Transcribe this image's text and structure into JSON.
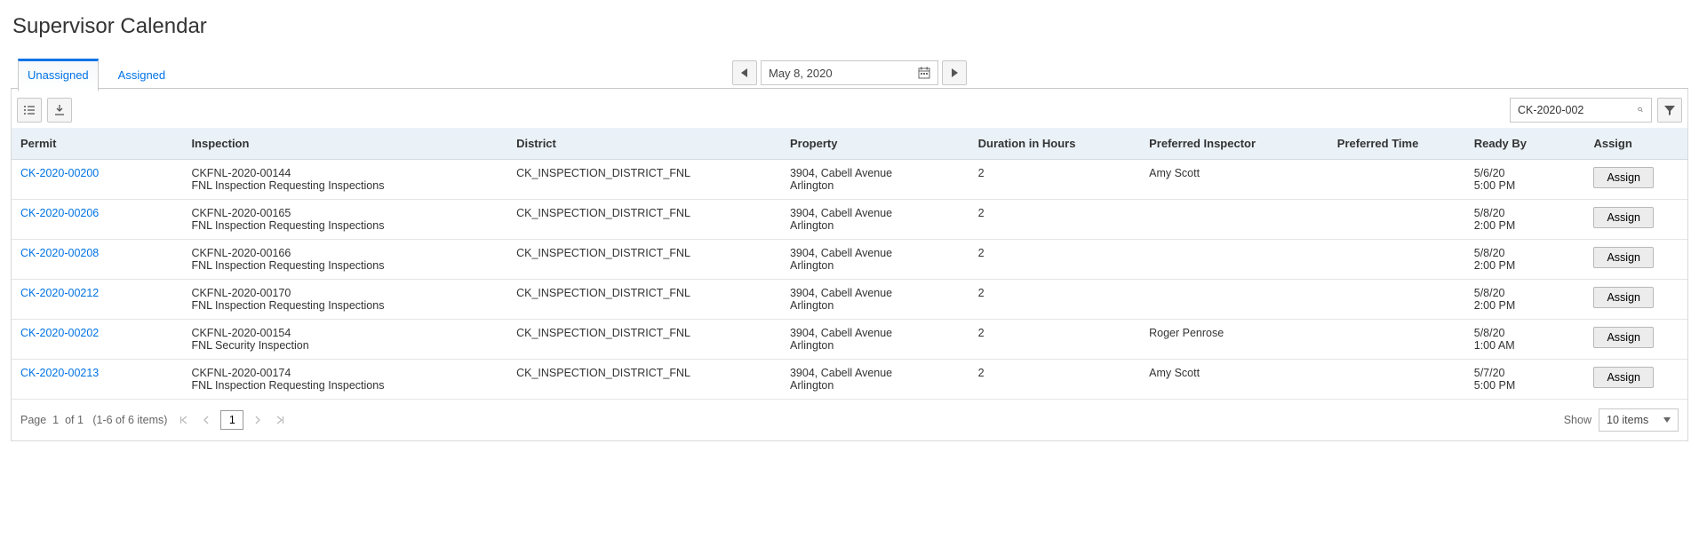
{
  "page_title": "Supervisor Calendar",
  "tabs": {
    "unassigned": "Unassigned",
    "assigned": "Assigned"
  },
  "date_value": "May 8, 2020",
  "search_value": "CK-2020-002",
  "columns": {
    "permit": "Permit",
    "inspection": "Inspection",
    "district": "District",
    "property": "Property",
    "duration": "Duration in Hours",
    "preferred_inspector": "Preferred Inspector",
    "preferred_time": "Preferred Time",
    "ready_by": "Ready By",
    "assign": "Assign"
  },
  "assign_label": "Assign",
  "rows": [
    {
      "permit": "CK-2020-00200",
      "inspection_id": "CKFNL-2020-00144",
      "inspection_type": "FNL Inspection Requesting Inspections",
      "district": "CK_INSPECTION_DISTRICT_FNL",
      "property_line1": "3904, Cabell Avenue",
      "property_line2": "Arlington",
      "duration": "2",
      "preferred_inspector": "Amy Scott",
      "preferred_time": "",
      "ready_date": "5/6/20",
      "ready_time": "5:00 PM"
    },
    {
      "permit": "CK-2020-00206",
      "inspection_id": "CKFNL-2020-00165",
      "inspection_type": "FNL Inspection Requesting Inspections",
      "district": "CK_INSPECTION_DISTRICT_FNL",
      "property_line1": "3904, Cabell Avenue",
      "property_line2": "Arlington",
      "duration": "2",
      "preferred_inspector": "",
      "preferred_time": "",
      "ready_date": "5/8/20",
      "ready_time": "2:00 PM"
    },
    {
      "permit": "CK-2020-00208",
      "inspection_id": "CKFNL-2020-00166",
      "inspection_type": "FNL Inspection Requesting Inspections",
      "district": "CK_INSPECTION_DISTRICT_FNL",
      "property_line1": "3904, Cabell Avenue",
      "property_line2": "Arlington",
      "duration": "2",
      "preferred_inspector": "",
      "preferred_time": "",
      "ready_date": "5/8/20",
      "ready_time": "2:00 PM"
    },
    {
      "permit": "CK-2020-00212",
      "inspection_id": "CKFNL-2020-00170",
      "inspection_type": "FNL Inspection Requesting Inspections",
      "district": "CK_INSPECTION_DISTRICT_FNL",
      "property_line1": "3904, Cabell Avenue",
      "property_line2": "Arlington",
      "duration": "2",
      "preferred_inspector": "",
      "preferred_time": "",
      "ready_date": "5/8/20",
      "ready_time": "2:00 PM"
    },
    {
      "permit": "CK-2020-00202",
      "inspection_id": "CKFNL-2020-00154",
      "inspection_type": "FNL Security Inspection",
      "district": "CK_INSPECTION_DISTRICT_FNL",
      "property_line1": "3904, Cabell Avenue",
      "property_line2": "Arlington",
      "duration": "2",
      "preferred_inspector": "Roger Penrose",
      "preferred_time": "",
      "ready_date": "5/8/20",
      "ready_time": "1:00 AM"
    },
    {
      "permit": "CK-2020-00213",
      "inspection_id": "CKFNL-2020-00174",
      "inspection_type": "FNL Inspection Requesting Inspections",
      "district": "CK_INSPECTION_DISTRICT_FNL",
      "property_line1": "3904, Cabell Avenue",
      "property_line2": "Arlington",
      "duration": "2",
      "preferred_inspector": "Amy Scott",
      "preferred_time": "",
      "ready_date": "5/7/20",
      "ready_time": "5:00 PM"
    }
  ],
  "pager": {
    "label_page": "Page",
    "current": "1",
    "of_label": "of 1",
    "range": "(1-6 of 6 items)",
    "page_input": "1",
    "show_label": "Show",
    "show_value": "10 items"
  }
}
